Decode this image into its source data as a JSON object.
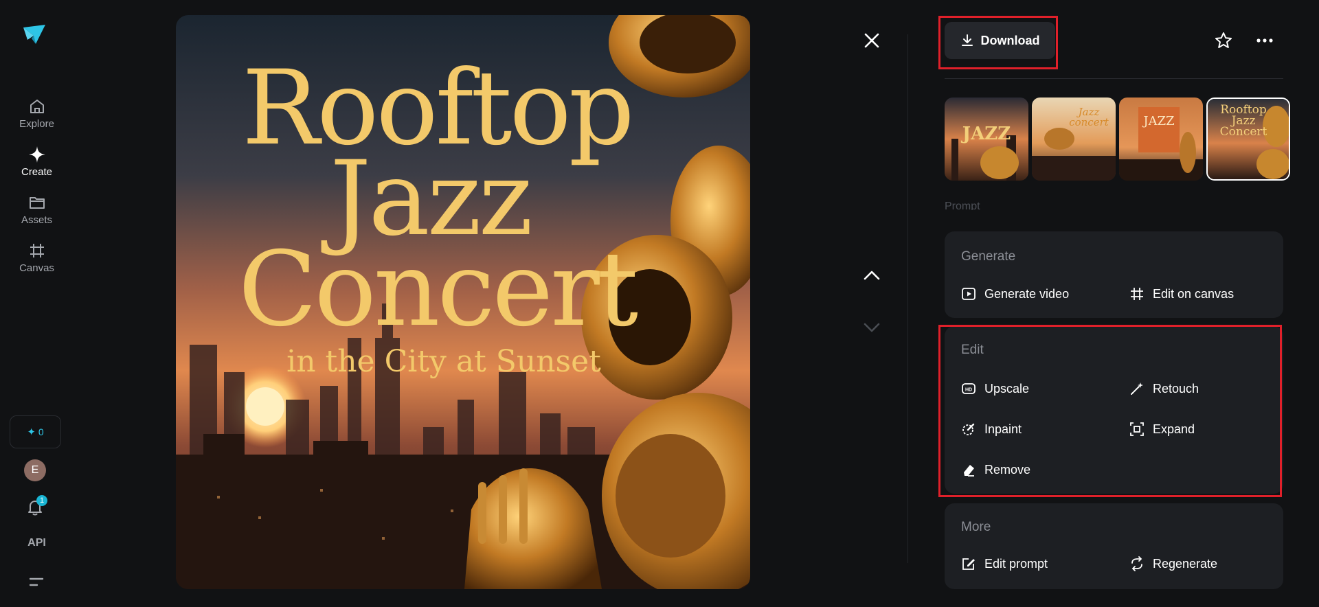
{
  "sidebar": {
    "items": [
      {
        "label": "Explore",
        "icon": "home-icon"
      },
      {
        "label": "Create",
        "icon": "sparkle-icon"
      },
      {
        "label": "Assets",
        "icon": "folder-icon"
      },
      {
        "label": "Canvas",
        "icon": "crop-icon"
      }
    ],
    "credits": "0",
    "avatar_initial": "E",
    "notifications": "1",
    "api_label": "API"
  },
  "poster": {
    "line1": "Rooftop",
    "line2": "Jazz",
    "line3": "Concert",
    "line4": "in the City at Sunset"
  },
  "panel": {
    "download_label": "Download",
    "prompt_label": "Prompt",
    "thumbs": [
      {
        "text": "JAZZ"
      },
      {
        "text": "Jazz concert"
      },
      {
        "text": "JAZZ"
      },
      {
        "text": "Rooftop Jazz Concert"
      }
    ],
    "generate": {
      "title": "Generate",
      "actions": [
        "Generate video",
        "Edit on canvas"
      ]
    },
    "edit": {
      "title": "Edit",
      "actions": [
        "Upscale",
        "Retouch",
        "Inpaint",
        "Expand",
        "Remove"
      ]
    },
    "more": {
      "title": "More",
      "actions": [
        "Edit prompt",
        "Regenerate"
      ]
    }
  },
  "colors": {
    "accent": "#2ec5e6",
    "highlight": "#e0202a",
    "background": "#111214",
    "card": "#1d1f23"
  }
}
